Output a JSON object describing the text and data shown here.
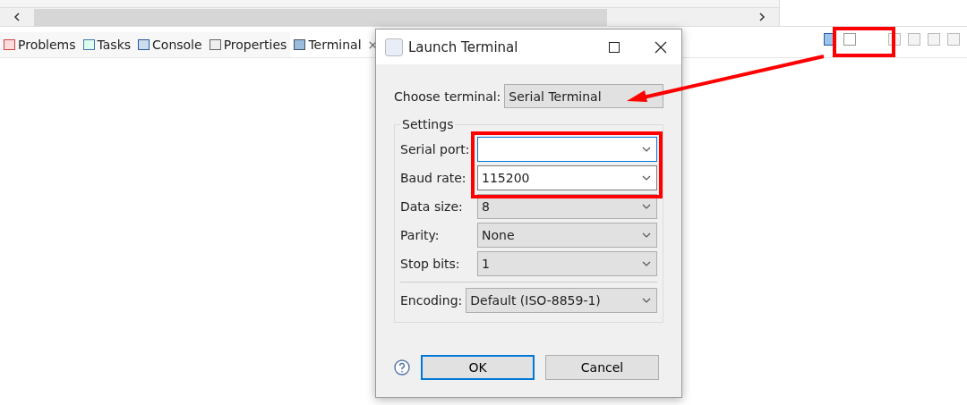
{
  "views": {
    "tabs": [
      {
        "label": "Problems",
        "selected": false
      },
      {
        "label": "Tasks",
        "selected": false
      },
      {
        "label": "Console",
        "selected": false
      },
      {
        "label": "Properties",
        "selected": false
      },
      {
        "label": "Terminal",
        "selected": true,
        "close": "×"
      }
    ]
  },
  "dialog": {
    "title": "Launch Terminal",
    "choose_label": "Choose terminal:",
    "choose_value": "Serial Terminal",
    "group_title": "Settings",
    "fields": [
      {
        "label": "Serial port:",
        "editable": true,
        "focused": true
      },
      {
        "label": "Baud rate:",
        "value": "115200",
        "editable": true,
        "focused": false
      },
      {
        "label": "Data size:",
        "value": "8",
        "editable": false,
        "focused": false
      },
      {
        "label": "Parity:",
        "value": "None",
        "editable": false,
        "focused": false
      },
      {
        "label": "Stop bits:",
        "value": "1",
        "editable": false,
        "focused": false
      }
    ],
    "encoding": {
      "label": "Encoding:",
      "value": "Default (ISO-8859-1)"
    },
    "buttons": [
      {
        "label": "OK",
        "default": true
      },
      {
        "label": "Cancel",
        "default": false
      }
    ]
  }
}
